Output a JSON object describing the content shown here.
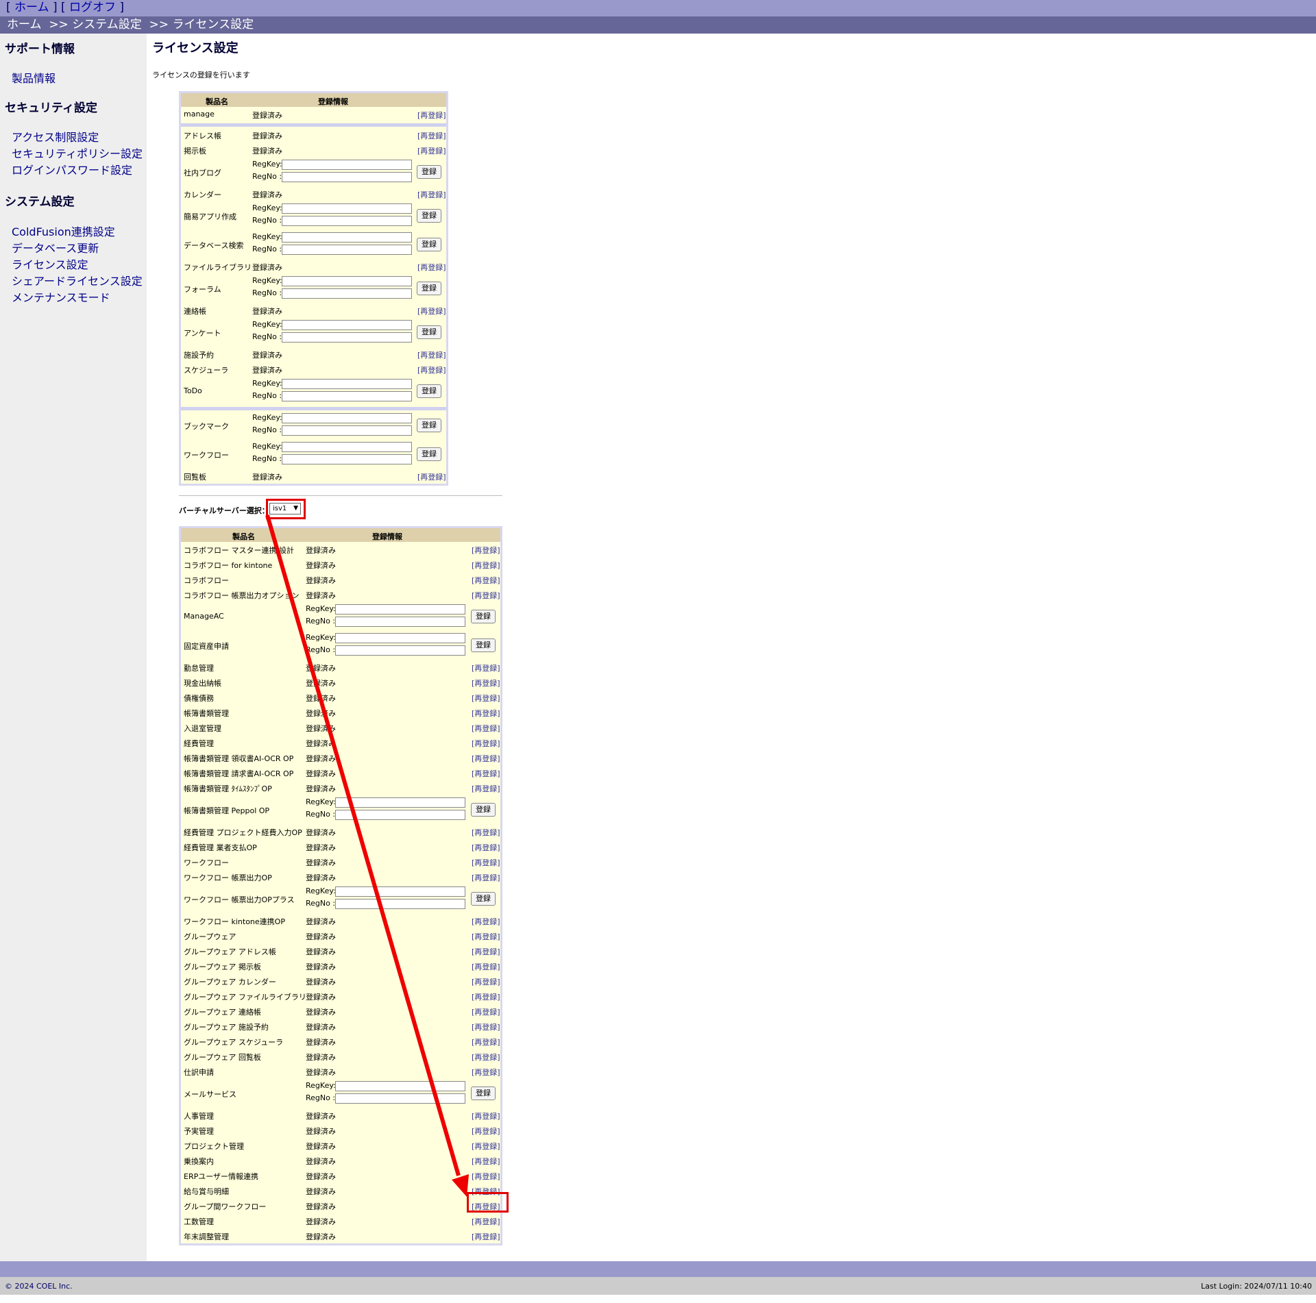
{
  "topnav": {
    "home_label": "ホーム",
    "logoff_label": "ログオフ"
  },
  "breadcrumb": {
    "home": "ホーム",
    "sep1": ">>",
    "system": "システム設定",
    "sep2": ">>",
    "current": "ライセンス設定"
  },
  "sidebar": {
    "sections": [
      {
        "title": "サポート情報",
        "items": [
          "製品情報"
        ]
      },
      {
        "title": "セキュリティ設定",
        "items": [
          "アクセス制限設定",
          "セキュリティポリシー設定",
          "ログインパスワード設定"
        ]
      },
      {
        "title": "システム設定",
        "items": [
          "ColdFusion連携設定",
          "データベース更新",
          "ライセンス設定",
          "シェアードライセンス設定",
          "メンテナンスモード"
        ]
      }
    ]
  },
  "main": {
    "title": "ライセンス設定",
    "description": "ライセンスの登録を行います",
    "col_product": "製品名",
    "col_info": "登録情報",
    "registered_text": "登録済み",
    "reregister_label": "[再登録]",
    "regkey_label": "RegKey:",
    "regno_label": "RegNo :",
    "register_button": "登録",
    "virtual_server_label": "バーチャルサーバー選択：",
    "virtual_server_value": "isv1"
  },
  "table1": [
    {
      "name": "manage",
      "type": "registered"
    },
    {
      "sep": true
    },
    {
      "name": "アドレス帳",
      "type": "registered"
    },
    {
      "name": "掲示板",
      "type": "registered"
    },
    {
      "name": "社内ブログ",
      "type": "input"
    },
    {
      "name": "カレンダー",
      "type": "registered"
    },
    {
      "name": "簡易アプリ作成",
      "type": "input"
    },
    {
      "name": "データベース検索",
      "type": "input"
    },
    {
      "name": "ファイルライブラリ",
      "type": "registered"
    },
    {
      "name": "フォーラム",
      "type": "input"
    },
    {
      "name": "連絡帳",
      "type": "registered"
    },
    {
      "name": "アンケート",
      "type": "input"
    },
    {
      "name": "施設予約",
      "type": "registered"
    },
    {
      "name": "スケジューラ",
      "type": "registered"
    },
    {
      "name": "ToDo",
      "type": "input"
    },
    {
      "sep": true
    },
    {
      "name": "ブックマーク",
      "type": "input"
    },
    {
      "name": "ワークフロー",
      "type": "input"
    },
    {
      "name": "回覧板",
      "type": "registered"
    }
  ],
  "table2": [
    {
      "name": "コラボフロー マスター連携 設計",
      "type": "registered"
    },
    {
      "name": "コラボフロー for kintone",
      "type": "registered"
    },
    {
      "name": "コラボフロー",
      "type": "registered"
    },
    {
      "name": "コラボフロー 帳票出力オプション",
      "type": "registered"
    },
    {
      "name": "ManageAC",
      "type": "input"
    },
    {
      "name": "固定資産申請",
      "type": "input"
    },
    {
      "name": "勤怠管理",
      "type": "registered"
    },
    {
      "name": "現金出納帳",
      "type": "registered"
    },
    {
      "name": "債権債務",
      "type": "registered"
    },
    {
      "name": "帳簿書類管理",
      "type": "registered"
    },
    {
      "name": "入退室管理",
      "type": "registered"
    },
    {
      "name": "経費管理",
      "type": "registered"
    },
    {
      "name": "帳簿書類管理 領収書AI-OCR OP",
      "type": "registered"
    },
    {
      "name": "帳簿書類管理 請求書AI-OCR OP",
      "type": "registered"
    },
    {
      "name": "帳簿書類管理 ﾀｲﾑｽﾀﾝﾌﾟOP",
      "type": "registered"
    },
    {
      "name": "帳簿書類管理 Peppol OP",
      "type": "input"
    },
    {
      "name": "経費管理 プロジェクト経費入力OP",
      "type": "registered"
    },
    {
      "name": "経費管理 業者支払OP",
      "type": "registered"
    },
    {
      "name": "ワークフロー",
      "type": "registered"
    },
    {
      "name": "ワークフロー 帳票出力OP",
      "type": "registered"
    },
    {
      "name": "ワークフロー 帳票出力OPプラス",
      "type": "input"
    },
    {
      "name": "ワークフロー kintone連携OP",
      "type": "registered"
    },
    {
      "name": "グループウェア",
      "type": "registered"
    },
    {
      "name": "グループウェア アドレス帳",
      "type": "registered"
    },
    {
      "name": "グループウェア 掲示板",
      "type": "registered"
    },
    {
      "name": "グループウェア カレンダー",
      "type": "registered"
    },
    {
      "name": "グループウェア ファイルライブラリ",
      "type": "registered"
    },
    {
      "name": "グループウェア 連絡帳",
      "type": "registered"
    },
    {
      "name": "グループウェア 施設予約",
      "type": "registered"
    },
    {
      "name": "グループウェア スケジューラ",
      "type": "registered"
    },
    {
      "name": "グループウェア 回覧板",
      "type": "registered"
    },
    {
      "name": "仕訳申請",
      "type": "registered"
    },
    {
      "name": "メールサービス",
      "type": "input"
    },
    {
      "name": "人事管理",
      "type": "registered"
    },
    {
      "name": "予実管理",
      "type": "registered"
    },
    {
      "name": "プロジェクト管理",
      "type": "registered"
    },
    {
      "name": "乗換案内",
      "type": "registered"
    },
    {
      "name": "ERPユーザー情報連携",
      "type": "registered"
    },
    {
      "name": "給与賞与明細",
      "type": "registered"
    },
    {
      "name": "グループ間ワークフロー",
      "type": "registered",
      "highlight": true
    },
    {
      "name": "工数管理",
      "type": "registered"
    },
    {
      "name": "年末調整管理",
      "type": "registered"
    }
  ],
  "footer": {
    "copyright": "© 2024 COEL Inc.",
    "last_login": "Last Login: 2024/07/11 10:40"
  },
  "colors": {
    "topnav_bg": "#9999cc",
    "breadcrumb_bg": "#666699",
    "sidebar_bg": "#eeeeee",
    "table_bg": "#ffffdd",
    "header_bg": "#ddd0aa",
    "highlight": "#e00000"
  }
}
